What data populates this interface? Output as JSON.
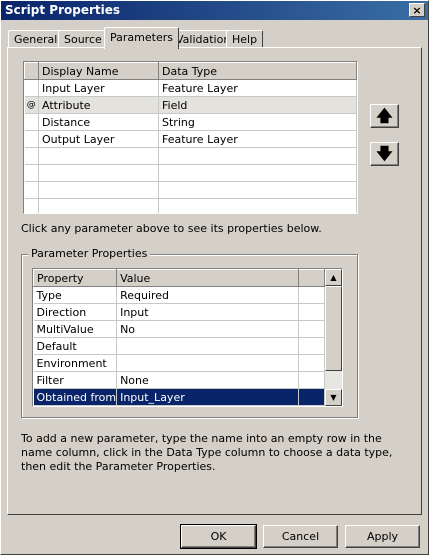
{
  "window": {
    "title": "Script Properties",
    "close_glyph": "×"
  },
  "tabs": [
    {
      "label": "General",
      "active": false
    },
    {
      "label": "Source",
      "active": false
    },
    {
      "label": "Parameters",
      "active": true
    },
    {
      "label": "Validation",
      "active": false
    },
    {
      "label": "Help",
      "active": false
    }
  ],
  "parameters_table": {
    "columns": [
      "Display Name",
      "Data Type"
    ],
    "rows": [
      {
        "selector": "",
        "display_name": "Input Layer",
        "data_type": "Feature Layer"
      },
      {
        "selector": "@",
        "display_name": "Attribute",
        "data_type": "Field"
      },
      {
        "selector": "",
        "display_name": "Distance",
        "data_type": "String"
      },
      {
        "selector": "",
        "display_name": "Output Layer",
        "data_type": "Feature Layer"
      }
    ],
    "empty_rows": 4
  },
  "move_buttons": {
    "up_glyph": "🡅",
    "down_glyph": "🡇"
  },
  "hint_text": "Click any parameter above to see its properties below.",
  "parameter_properties": {
    "group_label": "Parameter Properties",
    "columns": [
      "Property",
      "Value"
    ],
    "rows": [
      {
        "property": "Type",
        "value": "Required"
      },
      {
        "property": "Direction",
        "value": "Input"
      },
      {
        "property": "MultiValue",
        "value": "No"
      },
      {
        "property": "Default",
        "value": ""
      },
      {
        "property": "Environment",
        "value": ""
      },
      {
        "property": "Filter",
        "value": "None"
      },
      {
        "property": "Obtained from",
        "value": "Input_Layer"
      }
    ],
    "selected_row": "Obtained from"
  },
  "instructions": "To add a new parameter, type the name into an empty row in the name column, click in the Data Type column to choose a data type, then edit the Parameter Properties.",
  "buttons": {
    "ok": "OK",
    "cancel": "Cancel",
    "apply": "Apply"
  },
  "colors": {
    "title_bar": "#0a246a",
    "selection": "#0a246a",
    "dialog_bg": "#d4d0c8"
  }
}
